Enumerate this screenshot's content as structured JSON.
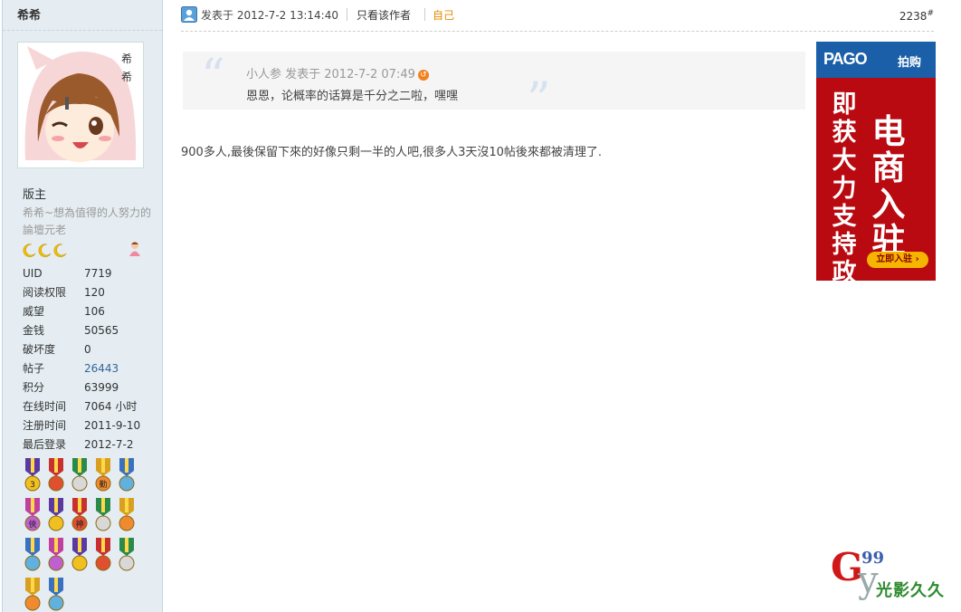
{
  "user": {
    "name": "希希",
    "group": "版主",
    "motto": "希希~想為值得的人努力的論壇元老",
    "stats": [
      {
        "label": "UID",
        "value": "7719"
      },
      {
        "label": "阅读权限",
        "value": "120"
      },
      {
        "label": "威望",
        "value": "106"
      },
      {
        "label": "金钱",
        "value": "50565"
      },
      {
        "label": "破坏度",
        "value": "0"
      },
      {
        "label": "帖子",
        "value": "26443"
      },
      {
        "label": "积分",
        "value": "63999"
      },
      {
        "label": "在线时间",
        "value": "7064 小时"
      },
      {
        "label": "注册时间",
        "value": "2011-9-10"
      },
      {
        "label": "最后登录",
        "value": "2012-7-2"
      }
    ],
    "avatar_text": "希\n希",
    "medals": [
      "3",
      "",
      "",
      "勤",
      "",
      "俠",
      "",
      "神",
      "",
      "",
      "",
      "",
      "",
      "",
      "",
      "",
      ""
    ]
  },
  "post": {
    "time": "发表于 2012-7-2 13:14:40",
    "only_author": "只看该作者",
    "self": "自己",
    "floor": "2238",
    "floor_mark": "#",
    "quote": {
      "meta": "小人参 发表于 2012-7-2 07:49",
      "text": "恩恩，论概率的话算是千分之二啦，嘿嘿"
    },
    "message": "900多人,最後保留下來的好像只剩一半的人吧,很多人3天沒10帖後來都被清理了."
  },
  "ad": {
    "brand": "PAGO",
    "brand_cn": "拍购",
    "left_text": "即获大力支持政策",
    "right_text": "电商入驻",
    "button": "立即入驻 ›"
  },
  "watermark": {
    "g": "G",
    "num": "99",
    "y": "y",
    "text": "光影久久"
  }
}
